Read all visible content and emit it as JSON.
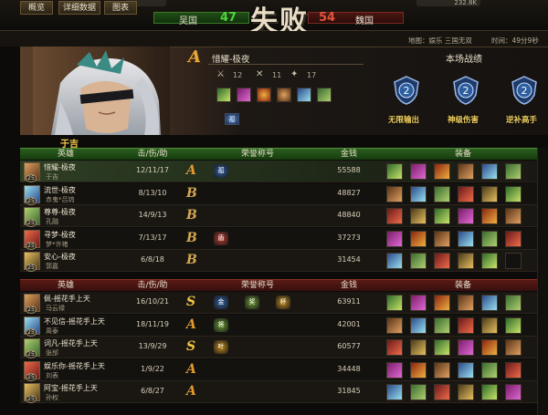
{
  "banner": {
    "left_faction": "吴国",
    "left_score": "47",
    "right_faction": "魏国",
    "right_score": "54",
    "result_title": "失败",
    "top_right_text": "232.8K"
  },
  "tabs": [
    {
      "label": "概览"
    },
    {
      "label": "详细数据"
    },
    {
      "label": "图表"
    }
  ],
  "map_info": "地图：娱乐 三国无双",
  "time_info": "时间：49分9秒",
  "panel": {
    "rank": "A",
    "hero_name": "惜耀-极夜",
    "kills": "12",
    "deaths": "11",
    "assists": "17",
    "match_title": "本场战绩",
    "honor_badge": "孤",
    "achievements": [
      {
        "label": "无限输出",
        "number": "2",
        "icon": "shield-badge-icon"
      },
      {
        "label": "神级伤害",
        "number": "2",
        "icon": "shield-badge-icon"
      },
      {
        "label": "逆补高手",
        "number": "2",
        "icon": "shield-badge-icon"
      }
    ]
  },
  "winner_label": "于吉",
  "table_headers": {
    "hero": "英雄",
    "kda": "击/伤/助",
    "honor": "荣誉称号",
    "gold": "金钱",
    "equipment": "装备"
  },
  "green_team": [
    {
      "player": "惜耀-极夜",
      "hero": "于吉",
      "level": "25",
      "kda": "12/11/17",
      "rank": "A",
      "gold": "55588",
      "honors": [
        "孤"
      ]
    },
    {
      "player": "流世-极夜",
      "hero": "赤鬼*吕钨",
      "level": "25",
      "kda": "8/13/10",
      "rank": "B",
      "gold": "48827",
      "honors": []
    },
    {
      "player": "尊尊-极夜",
      "hero": "孔融",
      "level": "25",
      "kda": "14/9/13",
      "rank": "B",
      "gold": "48840",
      "honors": []
    },
    {
      "player": "寻梦-极夜",
      "hero": "梦*许褚",
      "level": "25",
      "kda": "7/13/17",
      "rank": "B",
      "gold": "37273",
      "honors": [
        "盾"
      ]
    },
    {
      "player": "安心-极夜",
      "hero": "郭嘉",
      "level": "25",
      "kda": "6/8/18",
      "rank": "B",
      "gold": "31454",
      "honors": []
    }
  ],
  "red_team": [
    {
      "player": "佩-摇花手上天",
      "hero": "马云禄",
      "level": "25",
      "kda": "16/10/21",
      "rank": "S",
      "gold": "63911",
      "honors": [
        "金",
        "奖",
        "杯"
      ]
    },
    {
      "player": "不见信-摇花手上天",
      "hero": "周泰",
      "level": "25",
      "kda": "18/11/19",
      "rank": "A",
      "gold": "42001",
      "honors": [
        "将"
      ]
    },
    {
      "player": "词凡-摇花手上天",
      "hero": "张郃",
      "level": "25",
      "kda": "13/9/29",
      "rank": "S",
      "gold": "60577",
      "honors": [
        "叶"
      ]
    },
    {
      "player": "娱乐你-摇花手上天",
      "hero": "刘表",
      "level": "25",
      "kda": "1/9/22",
      "rank": "A",
      "gold": "34448",
      "honors": []
    },
    {
      "player": "阿宝-摇花手上天",
      "hero": "孙权",
      "level": "25",
      "kda": "6/8/27",
      "rank": "A",
      "gold": "31845",
      "honors": []
    }
  ],
  "colors": {
    "green_team": "#2a5e1e",
    "red_team": "#5a1a14",
    "score_green": "#4fd43a",
    "score_red": "#e0543a",
    "rank_gold": "#e29a2e"
  }
}
